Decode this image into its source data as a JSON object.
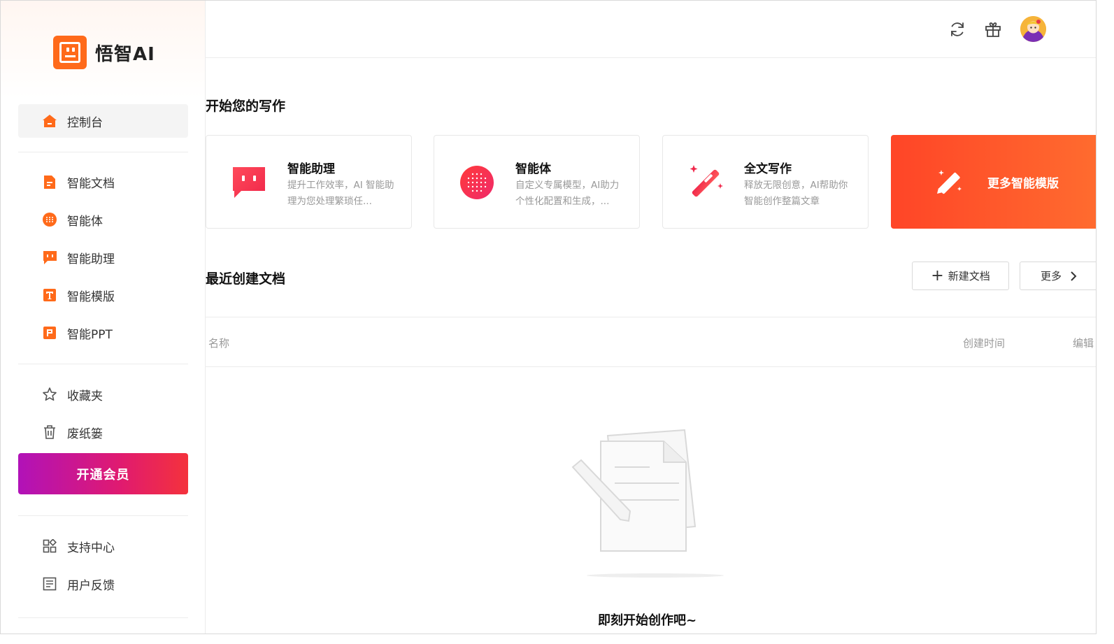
{
  "brand": {
    "name": "悟智AI",
    "accent": "#ff6a1a"
  },
  "sidebar": {
    "items": [
      {
        "label": "控制台",
        "icon": "home-icon",
        "active": true
      },
      {
        "label": "智能文档",
        "icon": "document-icon"
      },
      {
        "label": "智能体",
        "icon": "agent-icon"
      },
      {
        "label": "智能助理",
        "icon": "chat-assistant-icon"
      },
      {
        "label": "智能模版",
        "icon": "template-icon"
      },
      {
        "label": "智能PPT",
        "icon": "ppt-icon"
      },
      {
        "label": "收藏夹",
        "icon": "star-icon"
      },
      {
        "label": "废纸篓",
        "icon": "trash-icon"
      }
    ],
    "vip_label": "开通会员",
    "bottom_items": [
      {
        "label": "支持中心",
        "icon": "grid-icon"
      },
      {
        "label": "用户反馈",
        "icon": "feedback-icon"
      }
    ]
  },
  "topbar": {
    "icons": [
      "refresh-icon",
      "gift-icon",
      "avatar"
    ]
  },
  "main": {
    "start_title": "开始您的写作",
    "cards": [
      {
        "title": "智能助理",
        "desc": "提升工作效率，AI 智能助理为您处理繁琐任...",
        "icon": "chat-assistant-icon"
      },
      {
        "title": "智能体",
        "desc": "自定义专属模型，AI助力个性化配置和生成，...",
        "icon": "agent-icon"
      },
      {
        "title": "全文写作",
        "desc": "释放无限创意，AI帮助你智能创作整篇文章",
        "icon": "magic-wand-icon"
      }
    ],
    "more_card": {
      "title": "更多智能模版",
      "icon": "pencil-icon"
    },
    "recent_title": "最近创建文档",
    "new_doc_label": "新建文档",
    "more_label": "更多",
    "table_headers": {
      "name": "名称",
      "created": "创建时间",
      "edit": "编辑"
    },
    "empty_text": "即刻开始创作吧~"
  }
}
